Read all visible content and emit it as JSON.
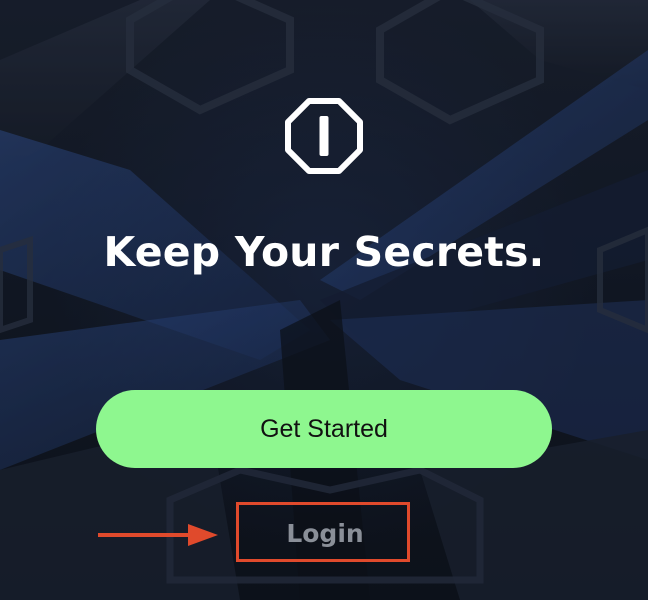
{
  "colors": {
    "background": "#121926",
    "accent_green": "#8ef78f",
    "login_text": "#8a8f98",
    "annotation_red": "#e04a2c"
  },
  "logo": {
    "icon": "octagon-slash-logo-icon"
  },
  "headline": "Keep Your Secrets.",
  "buttons": {
    "get_started": "Get Started",
    "login": "Login"
  },
  "annotation": {
    "icon": "right-arrow-icon"
  }
}
